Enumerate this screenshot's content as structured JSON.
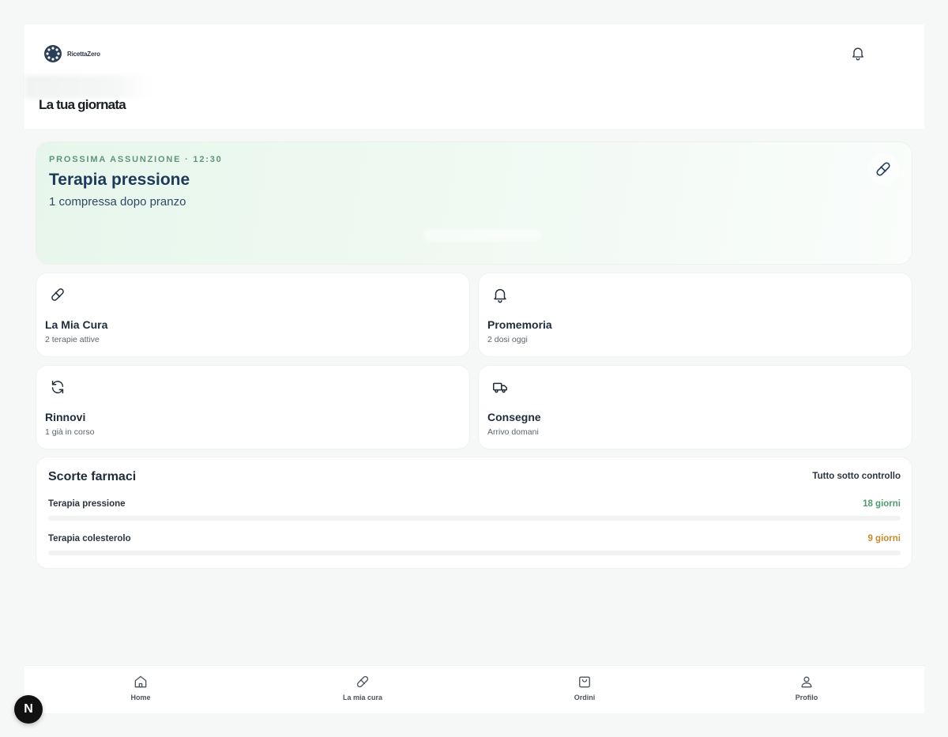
{
  "header": {
    "brand": "RicettaZero",
    "page_title": "La tua giornata"
  },
  "hero": {
    "kicker": "PROSSIMA ASSUNZIONE · 12:30",
    "title": "Terapia pressione",
    "subtitle": "1 compressa dopo pranzo"
  },
  "cards": [
    {
      "icon": "pill-icon",
      "title": "La Mia Cura",
      "subtitle": "2 terapie attive"
    },
    {
      "icon": "bell-icon",
      "title": "Promemoria",
      "subtitle": "2 dosi oggi"
    },
    {
      "icon": "refresh-icon",
      "title": "Rinnovi",
      "subtitle": "1 già in corso"
    },
    {
      "icon": "truck-icon",
      "title": "Consegne",
      "subtitle": "Arrivo domani"
    }
  ],
  "stock": {
    "title": "Scorte farmaci",
    "status": "Tutto sotto controllo",
    "rows": [
      {
        "name": "Terapia pressione",
        "days": "18 giorni",
        "fill": 0.0,
        "color": "#4f9a6e"
      },
      {
        "name": "Terapia colesterolo",
        "days": "9 giorni",
        "fill": 0.0,
        "color": "#c48a2e"
      }
    ]
  },
  "nav": {
    "items": [
      {
        "label": "Home",
        "icon": "home-icon"
      },
      {
        "label": "La mia cura",
        "icon": "pill-icon"
      },
      {
        "label": "Ordini",
        "icon": "bag-icon"
      },
      {
        "label": "Profilo",
        "icon": "user-icon"
      }
    ]
  },
  "fab": {
    "letter": "N"
  },
  "colors": {
    "accent_green": "#4f9a6e",
    "accent_amber": "#c48a2e",
    "hero_title": "#1d3a5a"
  }
}
